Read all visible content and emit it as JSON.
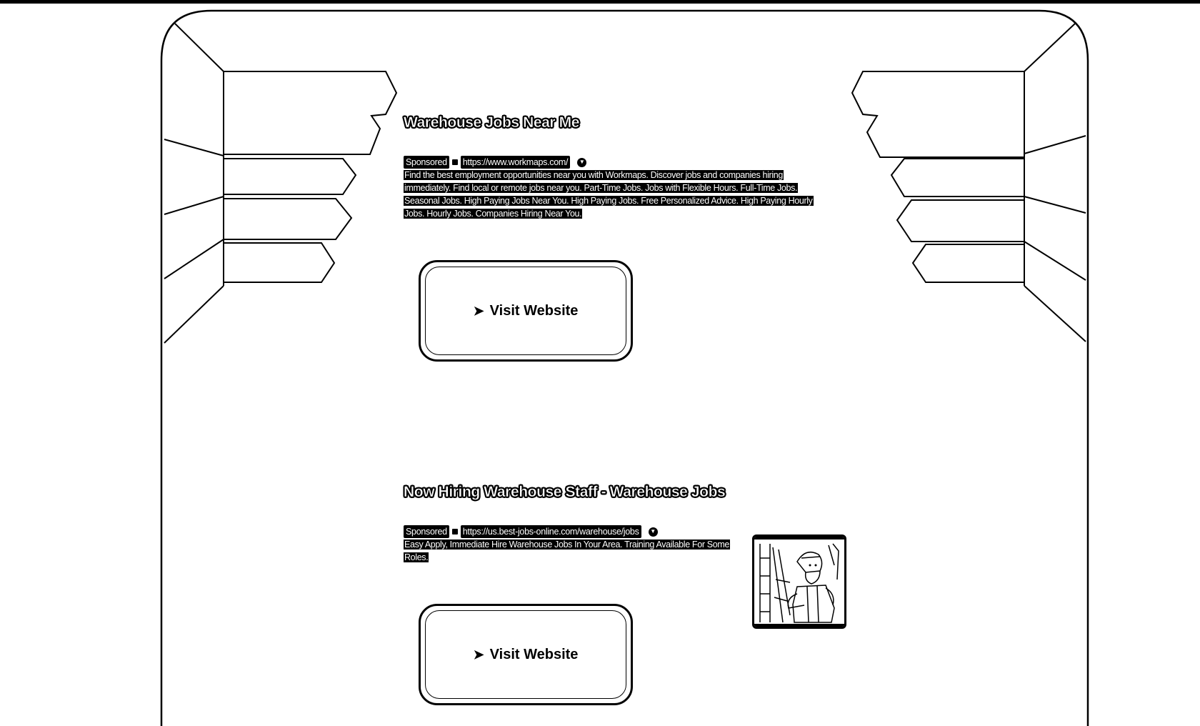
{
  "ads": [
    {
      "title": "Warehouse Jobs Near Me",
      "sponsored": "Sponsored",
      "url": "https://www.workmaps.com/",
      "description": "Find the best employment opportunities near you with Workmaps. Discover jobs and companies hiring immediately. Find local or remote jobs near you. Part-Time Jobs. Jobs with Flexible Hours. Full-Time Jobs. Seasonal Jobs. High Paying Jobs Near You. High Paying Jobs. Free Personalized Advice. High Paying Hourly Jobs. Hourly Jobs. Companies Hiring Near You.",
      "button_label": "Visit Website"
    },
    {
      "title": "Now Hiring Warehouse Staff - Warehouse Jobs",
      "sponsored": "Sponsored",
      "url": "https://us.best-jobs-online.com/warehouse/jobs",
      "description": "Easy Apply, Immediate Hire Warehouse Jobs In Your Area. Training Available For Some Roles.",
      "button_label": "Visit Website"
    }
  ],
  "icons": {
    "button_arrow": "➤",
    "dropdown": "▼"
  }
}
